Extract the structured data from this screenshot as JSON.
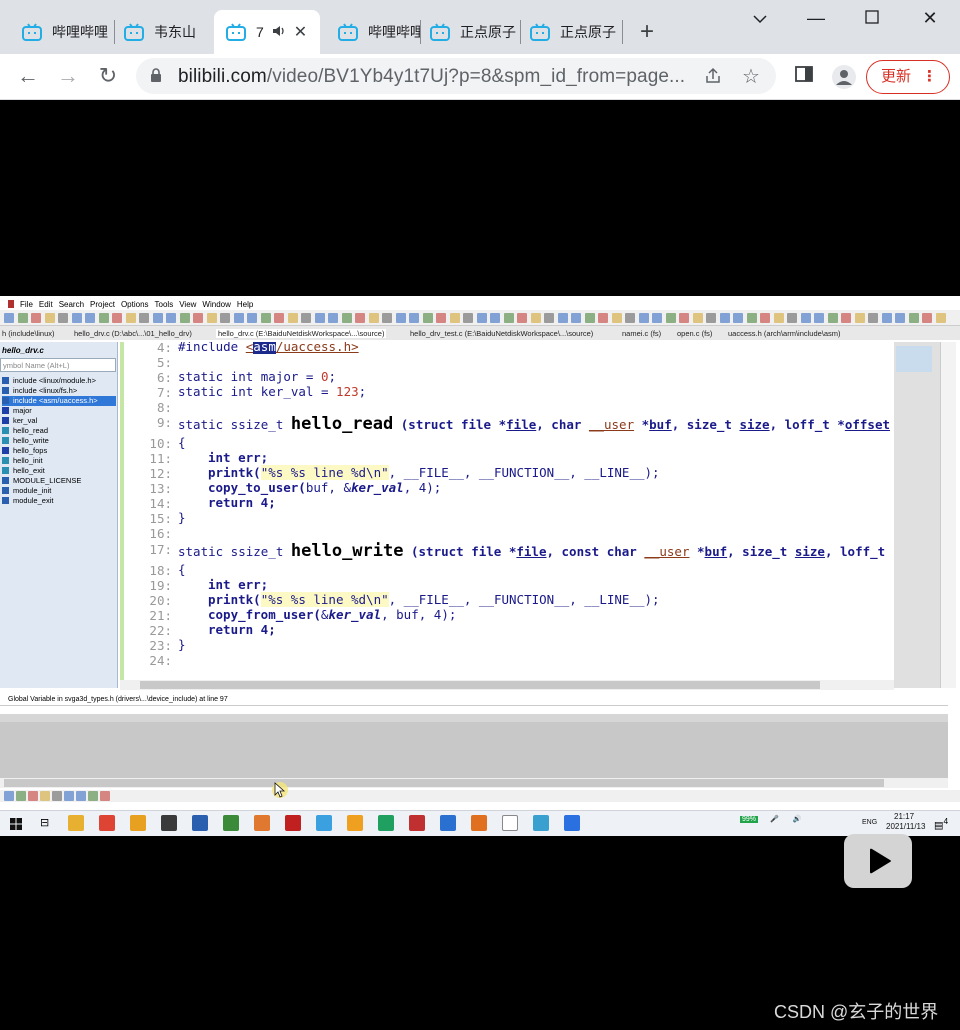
{
  "browser": {
    "tabs": [
      {
        "title": "哔哩哔哩",
        "active": false
      },
      {
        "title": "韦东山",
        "active": false
      },
      {
        "title": "7",
        "active": true
      },
      {
        "title": "哔哩哔哩",
        "active": false
      },
      {
        "title": "正点原子",
        "active": false
      },
      {
        "title": "正点原子",
        "active": false
      }
    ],
    "url_host": "bilibili.com",
    "url_path": "/video/BV1Yb4y1t7Uj?p=8&spm_id_from=page...",
    "update_label": "更新"
  },
  "ide": {
    "menus": [
      "File",
      "Edit",
      "Search",
      "Project",
      "Options",
      "Tools",
      "View",
      "Window",
      "Help"
    ],
    "doc_tabs": [
      "h (include\\linux)",
      "hello_drv.c (D:\\abc\\...\\01_hello_drv)",
      "hello_drv.c (E:\\BaiduNetdiskWorkspace\\...\\source)",
      "hello_drv_test.c (E:\\BaiduNetdiskWorkspace\\...\\source)",
      "namei.c (fs)",
      "open.c (fs)",
      "uaccess.h (arch\\arm\\include\\asm)"
    ],
    "symbol_panel": {
      "title": "hello_drv.c",
      "search_placeholder": "ymbol Name (Alt+L)",
      "items": [
        "include <linux/module.h>",
        "include <linux/fs.h>",
        "include <asm/uaccess.h>",
        "major",
        "ker_val",
        "hello_read",
        "hello_write",
        "hello_fops",
        "hello_init",
        "hello_exit",
        "MODULE_LICENSE",
        "module_init",
        "module_exit"
      ],
      "selected_index": 2
    },
    "line_numbers": [
      "4:",
      "5:",
      "6:",
      "7:",
      "8:",
      "9:",
      "10:",
      "11:",
      "12:",
      "13:",
      "14:",
      "15:",
      "16:",
      "17:",
      "18:",
      "19:",
      "20:",
      "21:",
      "22:",
      "23:",
      "24:"
    ],
    "code": {
      "l4a": "#include ",
      "l4b": "<",
      "l4c": "asm",
      "l4d": "/uaccess.h>",
      "l6": "static int major = ",
      "l6n": "0",
      "l7": "static int ker_val = ",
      "l7n": "123",
      "l9a": "static ssize_t ",
      "l9fn": "hello_read",
      "l9b": " (struct file *",
      "l9c": "file",
      "l9d": ", char ",
      "l9e": "__user",
      "l9f": " *",
      "l9g": "buf",
      "l9h": ", size_t ",
      "l9i": "size",
      "l9j": ", loff_t *",
      "l9k": "offset",
      "brace_open": "{",
      "brace_close": "}",
      "int_err": "int err;",
      "printk": "printk(",
      "printk_str": "\"%s %s line %d\\n\"",
      "printk_rest": ", __FILE__, __FUNCTION__, __LINE__);",
      "copy_to": "copy_to_user(",
      "copy_to_args1": "buf, &",
      "copy_to_args2": "ker_val",
      "copy_to_args3": ", 4);",
      "ret": "return 4;",
      "l17a": "static ssize_t ",
      "l17fn": "hello_write",
      "l17b": " (struct file *",
      "l17c": "file",
      "l17d": ", const char ",
      "l17e": "__user",
      "l17f": " *",
      "l17g": "buf",
      "l17h": ", size_t ",
      "l17i": "size",
      "l17j": ", loff_t",
      "copy_from": "copy_from_user(",
      "copy_from_args1": "&",
      "copy_from_args2": "ker_val",
      "copy_from_args3": ", buf, 4);"
    },
    "status_line": "Global Variable in svga3d_types.h (drivers\\...\\device_include) at line 97"
  },
  "taskbar": {
    "battery": "99%",
    "lang": "ENG",
    "time": "21:17",
    "date": "2021/11/13",
    "notif": "4"
  },
  "watermark": "CSDN @玄子的世界",
  "colors": {
    "bilibili": "#23ade5",
    "update_red": "#d93025",
    "selection": "#3078d8"
  }
}
